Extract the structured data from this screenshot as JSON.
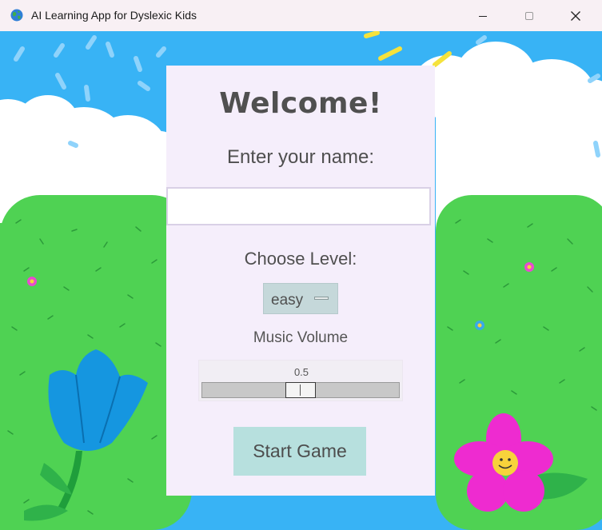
{
  "window": {
    "title": "AI Learning App for Dyslexic Kids",
    "icon": "globe-icon",
    "controls": [
      "minimize-icon",
      "maximize-icon",
      "close-icon"
    ]
  },
  "panel": {
    "welcome": "Welcome!",
    "name_prompt": "Enter your name:",
    "name_value": "",
    "level_prompt": "Choose Level:",
    "level_selected": "easy",
    "volume_label": "Music Volume",
    "volume_value": "0.5",
    "volume_level": 0.5,
    "start_label": "Start Game"
  },
  "colors": {
    "sky": "#38b3f5",
    "grass": "#4fd253",
    "panel": "#f5eefb",
    "button": "#b7e0de"
  }
}
